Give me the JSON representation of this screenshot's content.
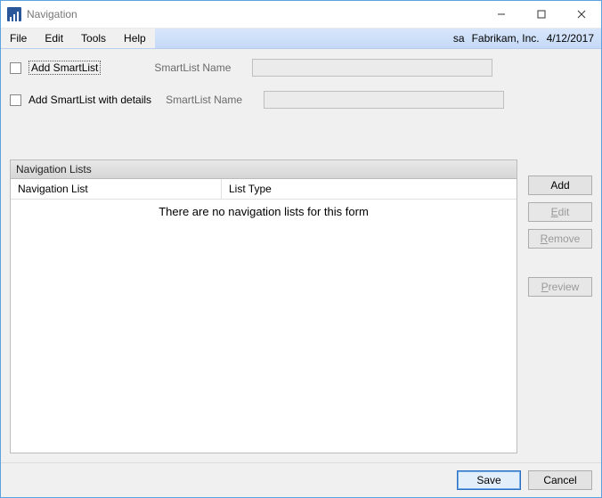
{
  "window": {
    "title": "Navigation"
  },
  "menubar": {
    "file": "File",
    "edit": "Edit",
    "tools": "Tools",
    "help": "Help",
    "user": "sa",
    "company": "Fabrikam, Inc.",
    "date": "4/12/2017"
  },
  "form": {
    "add_smartlist_label": "Add SmartList",
    "add_smartlist_details_label": "Add SmartList with details",
    "smartlist_name_label": "SmartList Name",
    "smartlist_name_value": "",
    "smartlist_name_details_value": ""
  },
  "panel": {
    "title": "Navigation Lists",
    "col1": "Navigation List",
    "col2": "List Type",
    "empty_message": "There are no navigation lists for this form"
  },
  "buttons": {
    "add": "Add",
    "edit_prefix": "E",
    "edit_rest": "dit",
    "remove_prefix": "R",
    "remove_rest": "emove",
    "preview_prefix": "P",
    "preview_rest": "review",
    "save": "Save",
    "cancel": "Cancel"
  }
}
